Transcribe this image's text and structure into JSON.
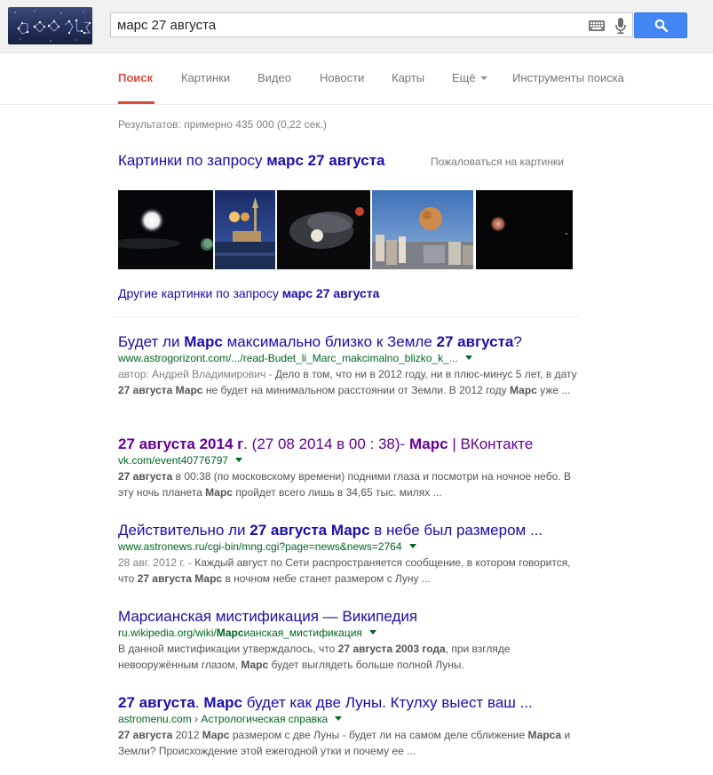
{
  "search": {
    "query": "марс 27 августа"
  },
  "tabs": [
    {
      "label": "Поиск"
    },
    {
      "label": "Картинки"
    },
    {
      "label": "Видео"
    },
    {
      "label": "Новости"
    },
    {
      "label": "Карты"
    },
    {
      "label": "Ещё"
    },
    {
      "label": "Инструменты поиска"
    }
  ],
  "stats": "Результатов: примерно 435 000 (0,22 сек.)",
  "images": {
    "heading_prefix": "Картинки по запросу ",
    "heading_query": "марс 27 августа",
    "report": "Пожаловаться на картинки",
    "more_prefix": "Другие картинки по запросу ",
    "more_query": "марс 27 августа"
  },
  "results": [
    {
      "title": [
        {
          "t": "Будет ли "
        },
        {
          "b": "Марс"
        },
        {
          "t": " максимально близко к Земле "
        },
        {
          "b": "27 августа"
        },
        {
          "t": "?"
        }
      ],
      "url": [
        {
          "t": "www.astrogorizont.com/.../read-Budet_li_Marc_makcimalno_blizko_k_..."
        }
      ],
      "snippet": [
        {
          "a": "автор: Андрей Владимирович - "
        },
        {
          "t": "Дело в том, что ни в 2012 году, ни в плюс-минус 5 лет, в дату "
        },
        {
          "b": "27 августа Марс"
        },
        {
          "t": " не будет на минимальном расстоянии от Земли. В 2012 году "
        },
        {
          "b": "Марс"
        },
        {
          "t": " уже ..."
        }
      ]
    },
    {
      "title": [
        {
          "b": "27 августа 2014 г"
        },
        {
          "t": ". (27 08 2014 в 00 : 38)- "
        },
        {
          "b": "Марс"
        },
        {
          "t": " | ВКонтакте"
        }
      ],
      "visited": true,
      "url": [
        {
          "t": "vk.com/event40776797"
        }
      ],
      "snippet": [
        {
          "b": "27 августа"
        },
        {
          "t": " в 00:38 (по московскому времени) подними глаза и посмотри на ночное небо. В эту ночь планета "
        },
        {
          "b": "Марс"
        },
        {
          "t": " пройдет всего лишь в 34,65 тыс. милях ..."
        }
      ]
    },
    {
      "title": [
        {
          "t": "Действительно ли "
        },
        {
          "b": "27 августа Марс"
        },
        {
          "t": " в небе был размером ..."
        }
      ],
      "url": [
        {
          "t": "www.astronews.ru/cgi-bin/mng.cgi?page=news&news=2764"
        }
      ],
      "snippet": [
        {
          "d": "28 авг. 2012 г. - "
        },
        {
          "t": "Каждый август по Сети распространяется сообщение, в котором говорится, что "
        },
        {
          "b": "27 августа Марс"
        },
        {
          "t": " в ночном небе станет размером с Луну ..."
        }
      ]
    },
    {
      "title": [
        {
          "t": "Марсианская мистификация — Википедия"
        }
      ],
      "url": [
        {
          "t": "ru.wikipedia.org/wiki/"
        },
        {
          "b": "Марс"
        },
        {
          "t": "ианская_мистификация"
        }
      ],
      "snippet": [
        {
          "t": "В данной мистификации утверждалось, что "
        },
        {
          "b": "27 августа 2003 года"
        },
        {
          "t": ", при взгляде невооружённым глазом, "
        },
        {
          "b": "Марс"
        },
        {
          "t": " будет выглядеть больше полной Луны."
        }
      ]
    },
    {
      "title": [
        {
          "b": "27 августа"
        },
        {
          "t": ". "
        },
        {
          "b": "Марс"
        },
        {
          "t": " будет как две Луны. Ктулху выест ваш ..."
        }
      ],
      "url": [
        {
          "t": "astromenu.com › Астрологическая справка"
        }
      ],
      "snippet": [
        {
          "b": "27 августа"
        },
        {
          "t": " 2012 "
        },
        {
          "b": "Марс"
        },
        {
          "t": " размером с две Луны - будет ли на самом деле сближение "
        },
        {
          "b": "Марса"
        },
        {
          "t": " и Земли? Происхождение этой ежегодной утки и почему ее ..."
        }
      ]
    }
  ],
  "colors": {
    "link": "#1a0dab",
    "visited": "#609",
    "url_green": "#006621",
    "active_tab": "#dd4b39",
    "search_button": "#4285f4"
  },
  "icons": [
    "keyboard-icon",
    "microphone-icon",
    "search-icon",
    "dropdown-caret-icon"
  ]
}
